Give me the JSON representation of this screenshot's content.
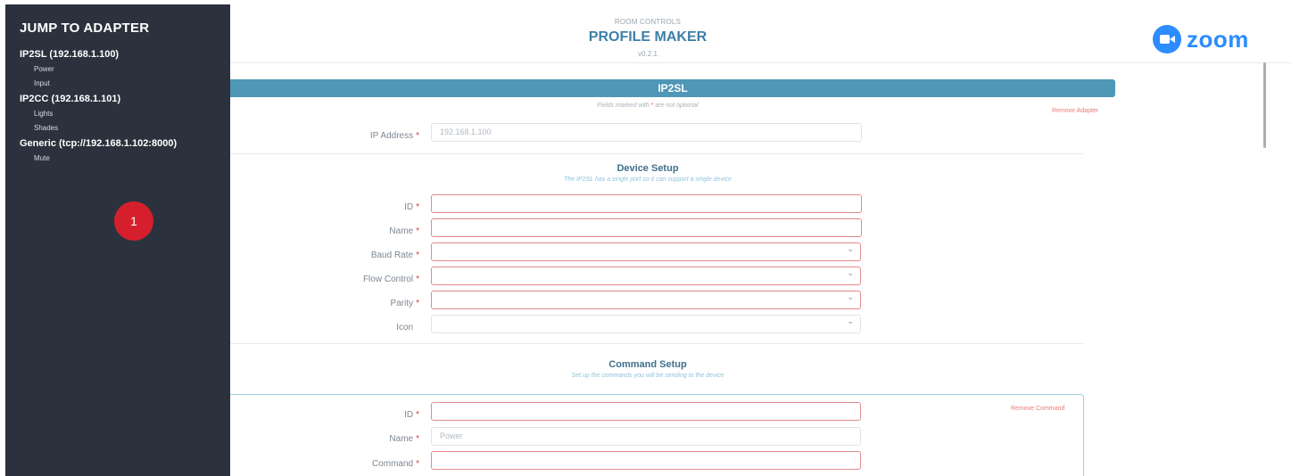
{
  "sidebar": {
    "title": "JUMP TO ADAPTER",
    "adapters": [
      {
        "label": "IP2SL (192.168.1.100)",
        "commands": [
          "Power",
          "Input"
        ]
      },
      {
        "label": "IP2CC (192.168.1.101)",
        "commands": [
          "Lights",
          "Shades"
        ]
      },
      {
        "label": "Generic (tcp://192.168.1.102:8000)",
        "commands": [
          "Mute"
        ]
      }
    ],
    "badge": "1"
  },
  "header": {
    "kicker": "ROOM CONTROLS",
    "title": "PROFILE MAKER",
    "version": "v0.2.1",
    "logo_text": "zoom"
  },
  "adapter": {
    "name": "IP2SL",
    "required_note_prefix": "Fields marked with ",
    "required_note_star": "*",
    "required_note_suffix": " are not optional",
    "remove_label": "Remove Adapter",
    "ip_label": "IP Address",
    "ip_placeholder": "192.168.1.100"
  },
  "device_setup": {
    "title": "Device Setup",
    "subtitle": "The IP2SL has a single port so it can support a single device",
    "fields": {
      "id_label": "ID",
      "name_label": "Name",
      "baud_label": "Baud Rate",
      "flow_label": "Flow Control",
      "parity_label": "Parity",
      "icon_label": "Icon"
    }
  },
  "command_setup": {
    "title": "Command Setup",
    "subtitle": "Set up the commands you will be sending to the device",
    "remove_label": "Remove Command",
    "id_label": "ID",
    "name_label": "Name",
    "name_placeholder": "Power",
    "command_label": "Command"
  },
  "colors": {
    "sidebar_bg": "#2b323d",
    "accent": "#4f97b6",
    "required": "#e03b3b",
    "zoom_blue": "#2d8cff",
    "badge_red": "#d61f2c"
  }
}
